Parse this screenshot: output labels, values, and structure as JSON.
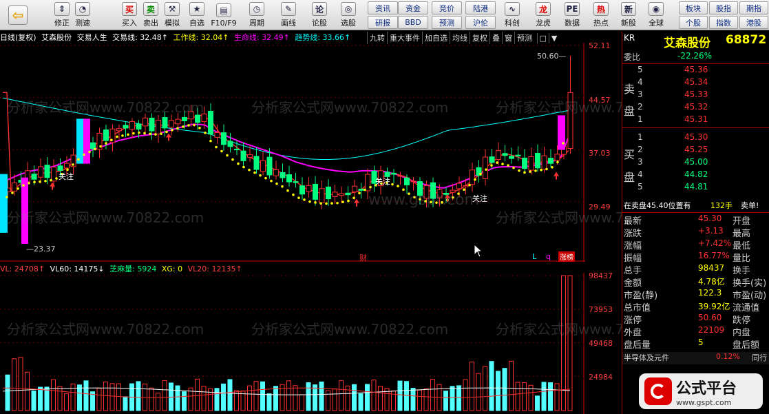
{
  "toolbar": {
    "buttons": [
      {
        "label": "",
        "icon": "back-arrow-icon"
      },
      {
        "label": "修正",
        "icon": "up-down-arrows-icon"
      },
      {
        "label": "测速",
        "icon": "speed-gauge-icon"
      },
      {
        "label": "买入",
        "icon": "buy-icon"
      },
      {
        "label": "卖出",
        "icon": "sell-icon"
      },
      {
        "label": "模拟",
        "icon": "gavel-icon"
      },
      {
        "label": "自选",
        "icon": "star-icon"
      },
      {
        "label": "F10/F9",
        "icon": "f10-icon"
      },
      {
        "label": "周期",
        "icon": "clock-icon"
      },
      {
        "label": "画线",
        "icon": "draw-line-icon"
      },
      {
        "label": "论股",
        "icon": "discuss-icon"
      },
      {
        "label": "选股",
        "icon": "select-stock-icon"
      },
      {
        "label": "科创",
        "icon": "sci-tech-icon"
      },
      {
        "label": "龙虎",
        "icon": "dragon-tiger-icon"
      },
      {
        "label": "数据",
        "icon": "pe-data-icon"
      },
      {
        "label": "热点",
        "icon": "hot-icon"
      },
      {
        "label": "新股",
        "icon": "new-stock-icon"
      },
      {
        "label": "全球",
        "icon": "globe-icon"
      }
    ],
    "grid_buttons": [
      "资讯",
      "资金",
      "竞价",
      "陆港",
      "研报",
      "BBD",
      "预测",
      "沪伦"
    ],
    "right_buttons": [
      "板块",
      "股指",
      "期指",
      "个股",
      "指数",
      "港股"
    ]
  },
  "chart_header": {
    "items": [
      "日线(复权)",
      "艾森股份",
      "交易人生",
      "交易线: 32.48↑",
      "工作线: 32.04↑",
      "生命线: 32.49↑",
      "趋势线: 33.66↑"
    ],
    "tabs": [
      "九转",
      "重大事件",
      "加自选",
      "均线",
      "复权",
      "叠",
      "窗",
      "预测"
    ]
  },
  "chart_colors": {
    "up": "#ff3030",
    "down": "#00ff7f",
    "trade_line": "#ffffff",
    "work_line": "#ffff00",
    "life_line": "#ff00ff",
    "trend_line": "#00ffff",
    "axis": "#ff3030"
  },
  "price_axis": {
    "ticks": [
      "52.11",
      "44.57",
      "37.03",
      "29.49"
    ],
    "high_label": "50.60",
    "low_label": "23.37"
  },
  "chart_annotations": {
    "focus": "关注",
    "focus2": "关注",
    "focus3": "关注",
    "finance": "财",
    "limit_up": "涨榜",
    "l": "L",
    "q": "q"
  },
  "volume_header": {
    "items": [
      "VL: 24708↑",
      "VL60: 14175↓",
      "芝麻量: 5924",
      "XG: 0",
      "VL20: 12135↑"
    ]
  },
  "volume_axis": {
    "ticks": [
      "98437",
      "73953",
      "49468",
      "24984"
    ]
  },
  "chart_data": [
    {
      "type": "candlestick",
      "title": "",
      "values_visible": {
        "high": 50.6,
        "low": 23.37,
        "last": 45.3
      }
    },
    {
      "type": "bar",
      "title": "",
      "values": [
        98437,
        24984
      ]
    }
  ],
  "right_panel": {
    "code_label": "KR",
    "stock_name": "艾森股份",
    "stock_code": "68872",
    "weibi_label": "委比",
    "weibi_value": "-22.26%",
    "sell_label_1": "卖",
    "sell_label_2": "盘",
    "buy_label_1": "买",
    "buy_label_2": "盘",
    "sell": [
      {
        "level": "5",
        "price": "45.36"
      },
      {
        "level": "4",
        "price": "45.34"
      },
      {
        "level": "3",
        "price": "45.33"
      },
      {
        "level": "2",
        "price": "45.32"
      },
      {
        "level": "1",
        "price": "45.31"
      }
    ],
    "buy": [
      {
        "level": "1",
        "price": "45.30"
      },
      {
        "level": "2",
        "price": "45.25"
      },
      {
        "level": "3",
        "price": "45.00"
      },
      {
        "level": "4",
        "price": "44.82"
      },
      {
        "level": "5",
        "price": "44.81"
      }
    ],
    "pending_text": "在卖盘45.40位置有",
    "pending_qty": "132手",
    "pending_tag": "卖单!",
    "stats": [
      {
        "l": "最新",
        "v": "45.30",
        "r": "开盘"
      },
      {
        "l": "涨跌",
        "v": "+3.13",
        "r": "最高"
      },
      {
        "l": "涨幅",
        "v": "+7.42%",
        "r": "最低"
      },
      {
        "l": "振幅",
        "v": "16.77%",
        "r": "量比"
      },
      {
        "l": "总手",
        "v": "98437",
        "r": "换手"
      },
      {
        "l": "金额",
        "v": "4.78亿",
        "r": "换手(实)"
      },
      {
        "l": "市盈(静)",
        "v": "122.3",
        "r": "市盈(动)"
      },
      {
        "l": "总市值",
        "v": "39.92亿",
        "r": "流通值"
      },
      {
        "l": "涨停",
        "v": "50.60",
        "r": "跌停"
      },
      {
        "l": "外盘",
        "v": "22109",
        "r": "内盘"
      },
      {
        "l": "盘后量",
        "v": "5",
        "r": "盘后额"
      }
    ],
    "sector_name": "半导体及元件",
    "sector_change": "0.12%",
    "sector_tab": "同行"
  },
  "watermarks": {
    "text1": "分析家公式网www.70822.com",
    "text2": "www.gspt.com"
  },
  "logo": {
    "text": "公式平台",
    "url_text": "www.gspt.com"
  }
}
